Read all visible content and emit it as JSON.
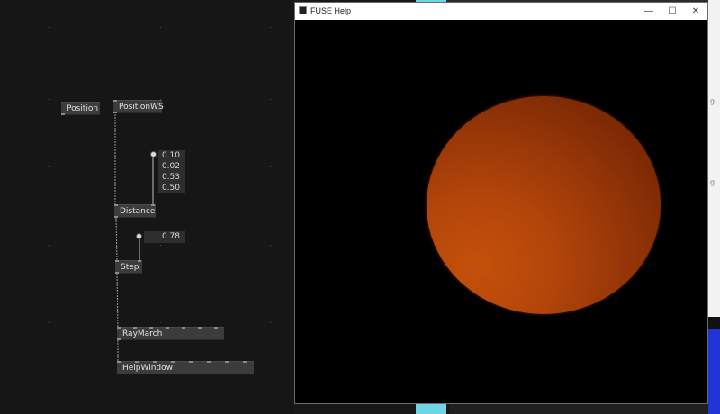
{
  "editor": {
    "nodes": {
      "position": "Position",
      "position_ws": "PositionWS",
      "distance": "Distance",
      "step": "Step",
      "raymarch": "RayMarch",
      "help_window": "HelpWindow"
    },
    "distance_values": [
      "0.10",
      "0.02",
      "0.53",
      "0.50"
    ],
    "step_value": "0.78"
  },
  "window": {
    "title": "FUSE Help",
    "minimize_icon": "minimize-icon",
    "maximize_icon": "maximize-icon",
    "close_icon": "close-icon"
  },
  "render": {
    "background": "#000000",
    "sphere_color": "#b4460a"
  }
}
